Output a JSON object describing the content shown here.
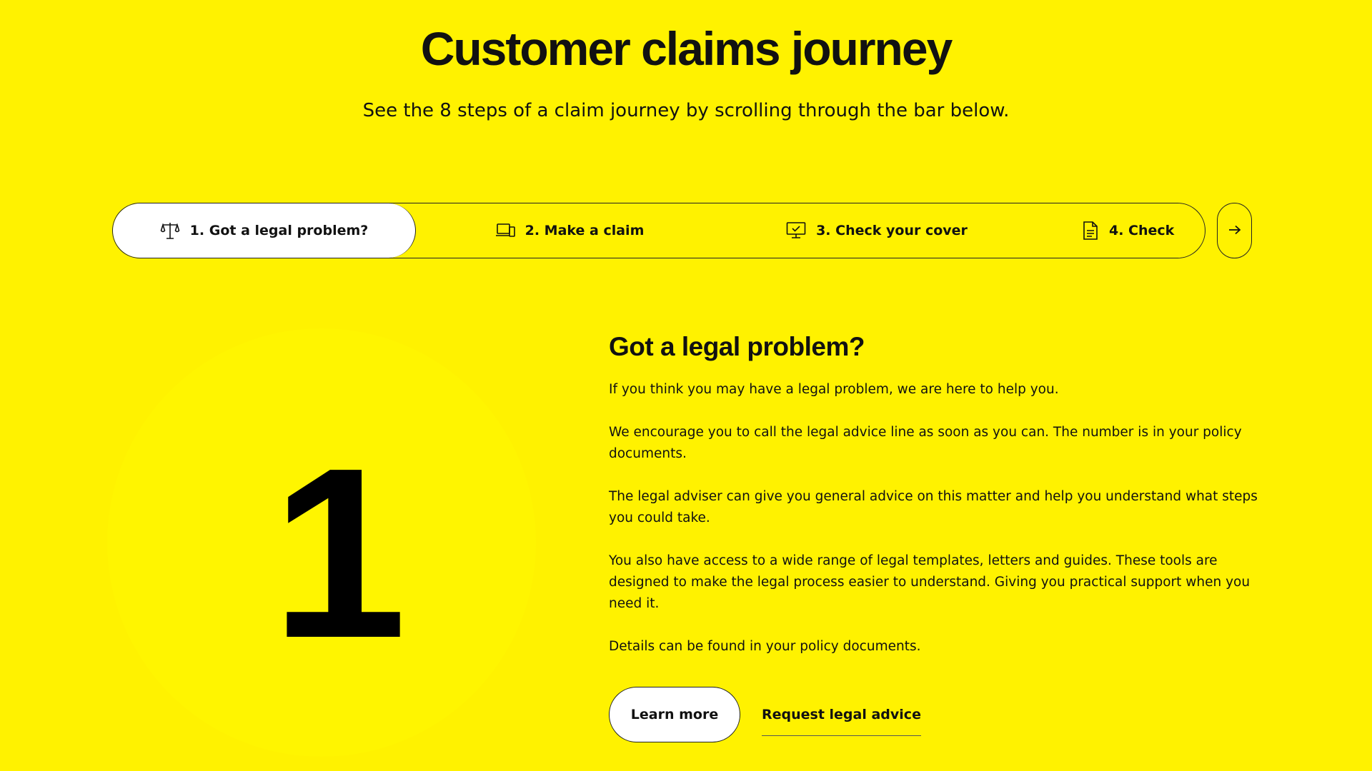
{
  "header": {
    "title": "Customer claims journey",
    "subtitle": "See the 8 steps of a claim journey by scrolling through the bar below."
  },
  "stepbar": {
    "steps": [
      {
        "label": "1. Got a legal problem?",
        "icon": "scales-icon",
        "active": true
      },
      {
        "label": "2. Make a claim",
        "icon": "devices-icon",
        "active": false
      },
      {
        "label": "3. Check your cover",
        "icon": "monitor-check-icon",
        "active": false
      },
      {
        "label": "4. Check",
        "icon": "document-icon",
        "active": false
      }
    ],
    "next_icon": "arrow-right-icon"
  },
  "step_detail": {
    "number": "1",
    "heading": "Got a legal problem?",
    "paragraphs": [
      "If you think you may have a legal problem, we are here to help you.",
      "We encourage you to call the legal advice line as soon as you can. The number is in your policy documents.",
      "The legal adviser can give you general advice on this matter and help you understand what steps you could take.",
      "You also have access to a wide range of legal templates, letters and guides. These tools are designed to make the legal process easier to understand. Giving you practical support when you need it.",
      "Details can be found in your policy documents."
    ],
    "learn_more_label": "Learn more",
    "request_advice_label": "Request legal advice"
  },
  "colors": {
    "background": "#fff200",
    "circle": "#fff500",
    "text": "#111111",
    "active_step": "#ffffff"
  }
}
